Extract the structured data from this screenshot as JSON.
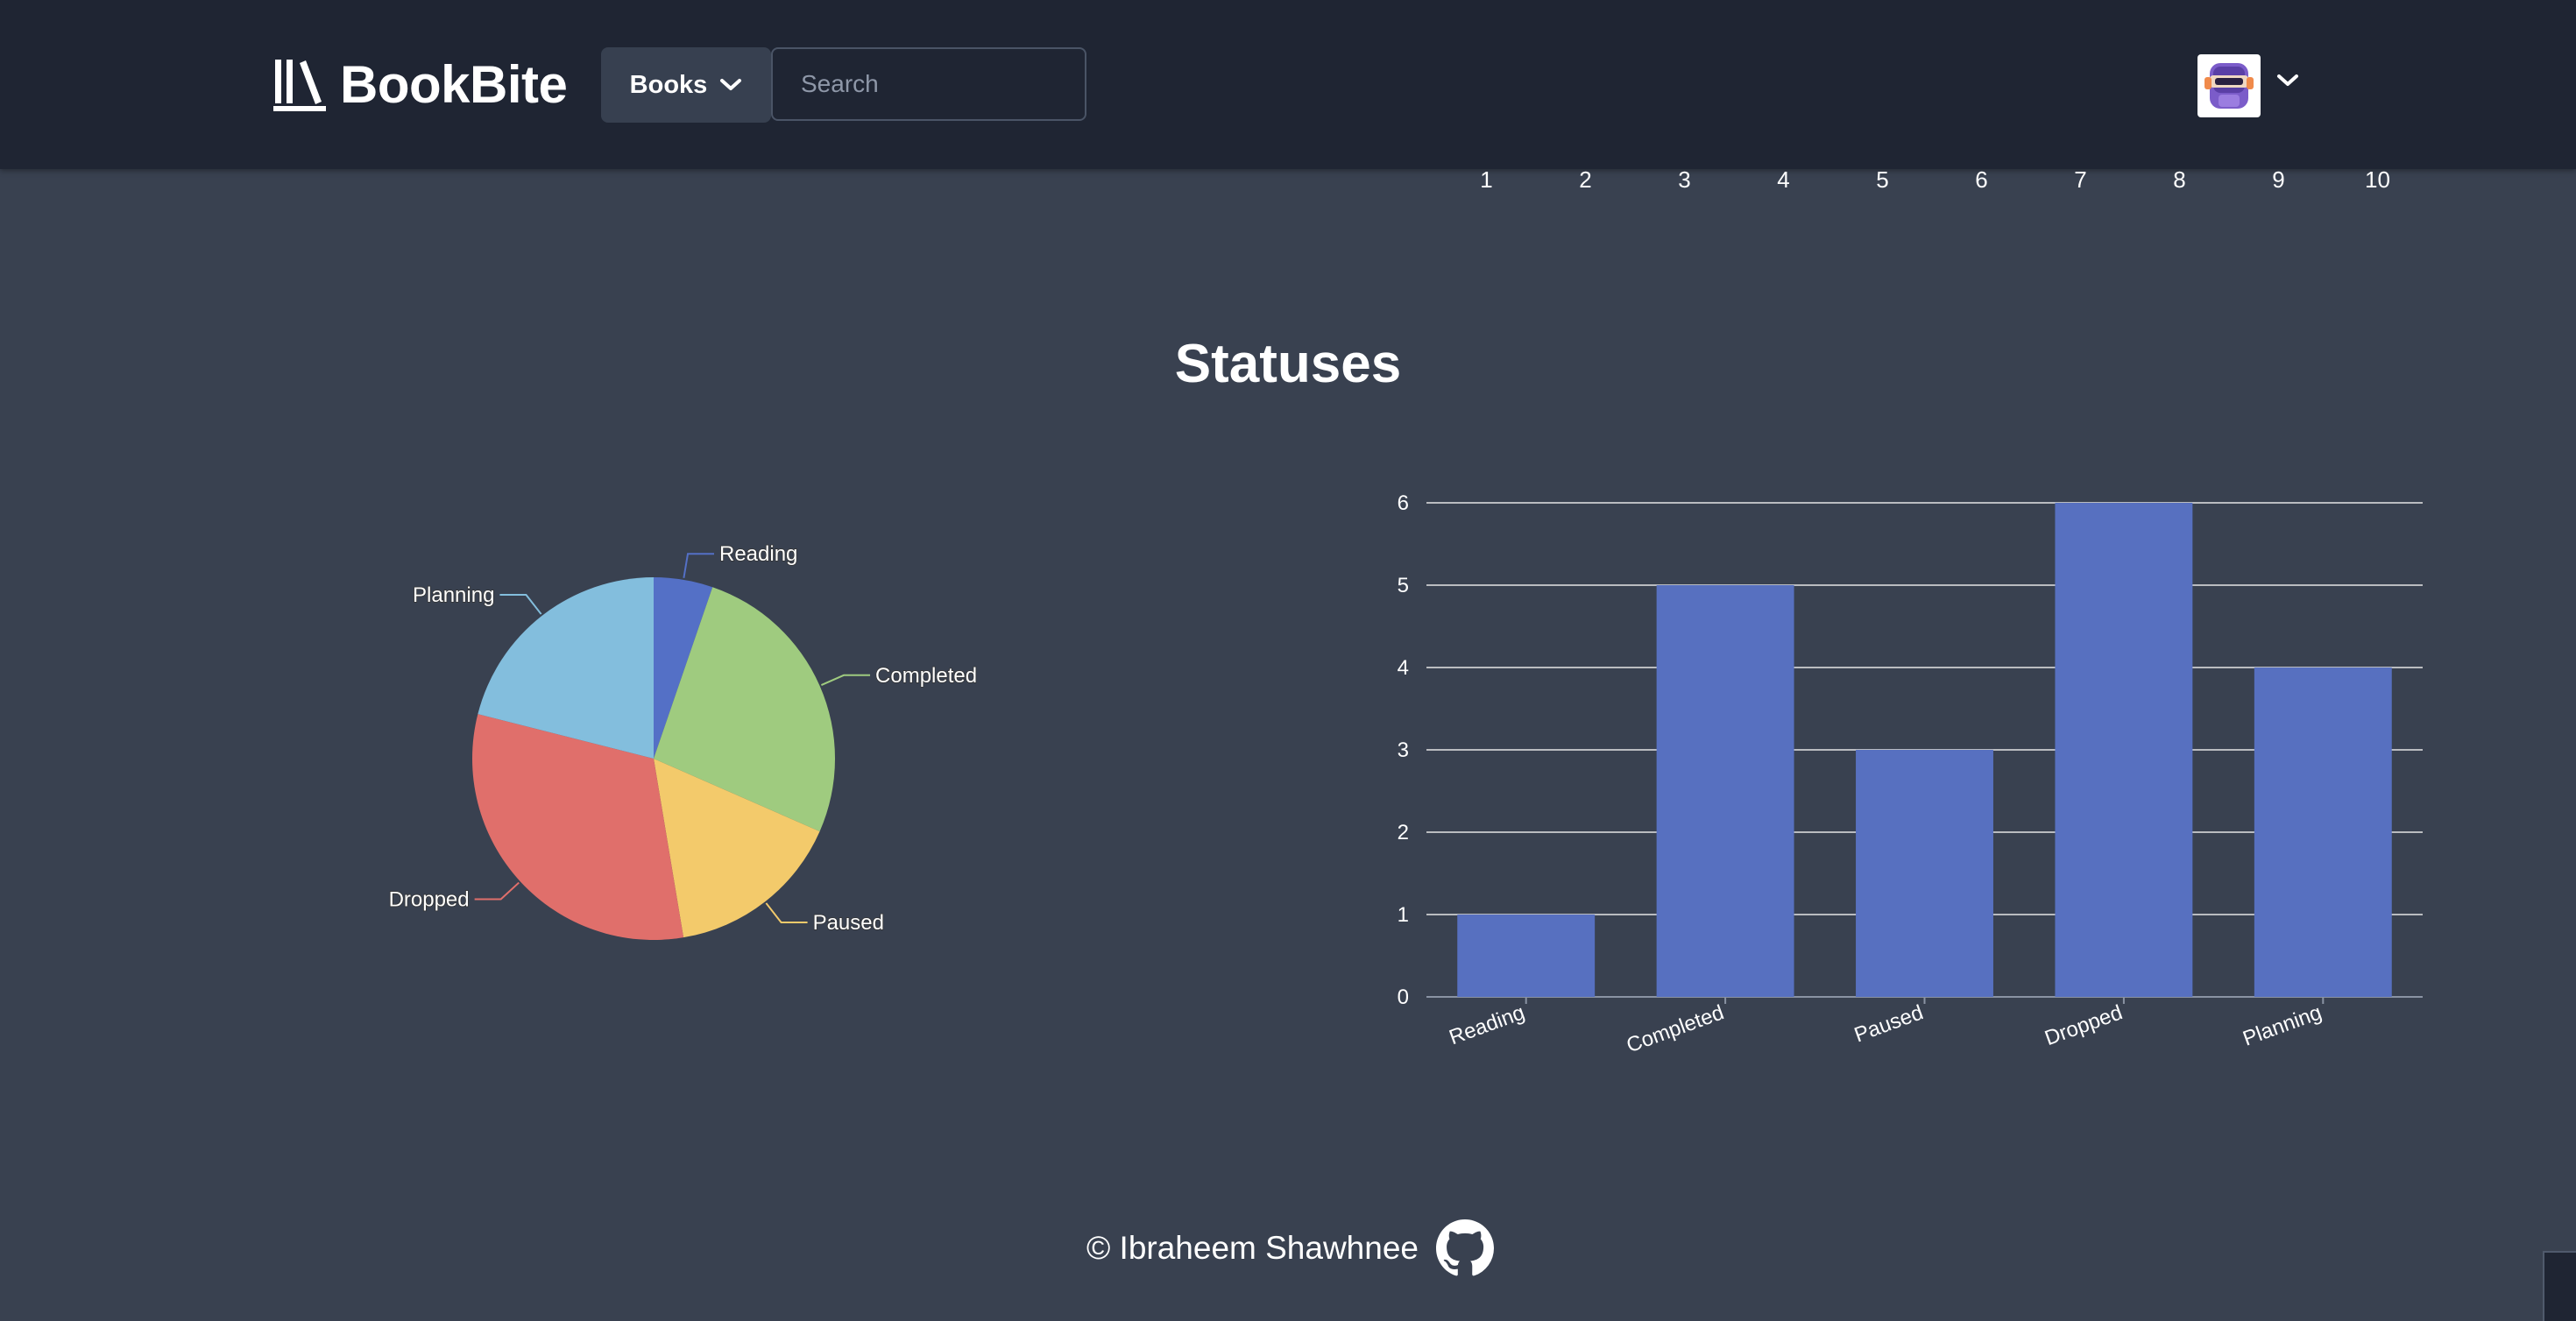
{
  "brand": {
    "name": "BookBite"
  },
  "nav": {
    "books_label": "Books"
  },
  "search": {
    "placeholder": "Search"
  },
  "pagination": [
    "1",
    "2",
    "3",
    "4",
    "5",
    "6",
    "7",
    "8",
    "9",
    "10"
  ],
  "section": {
    "title": "Statuses"
  },
  "colors": {
    "background": "#394150",
    "navbar": "#1f2533",
    "bar": "#5770c0",
    "reading": "#5470c6",
    "completed": "#9fcb7f",
    "paused": "#f3ca6b",
    "dropped": "#e06f6b",
    "planning": "#83bedd"
  },
  "chart_data": [
    {
      "type": "pie",
      "title": "",
      "labels": [
        "Reading",
        "Completed",
        "Paused",
        "Dropped",
        "Planning"
      ],
      "values": [
        1,
        5,
        3,
        6,
        4
      ],
      "colors": [
        "#5470c6",
        "#9fcb7f",
        "#f3ca6b",
        "#e06f6b",
        "#83bedd"
      ]
    },
    {
      "type": "bar",
      "title": "",
      "categories": [
        "Reading",
        "Completed",
        "Paused",
        "Dropped",
        "Planning"
      ],
      "values": [
        1,
        5,
        3,
        6,
        4
      ],
      "ylim": [
        0,
        6
      ],
      "yticks": [
        "0",
        "1",
        "2",
        "3",
        "4",
        "5",
        "6"
      ],
      "grid": true,
      "xlabel": "",
      "ylabel": ""
    }
  ],
  "footer": {
    "text": "© Ibraheem Shawhnee",
    "icon": "github-icon"
  }
}
